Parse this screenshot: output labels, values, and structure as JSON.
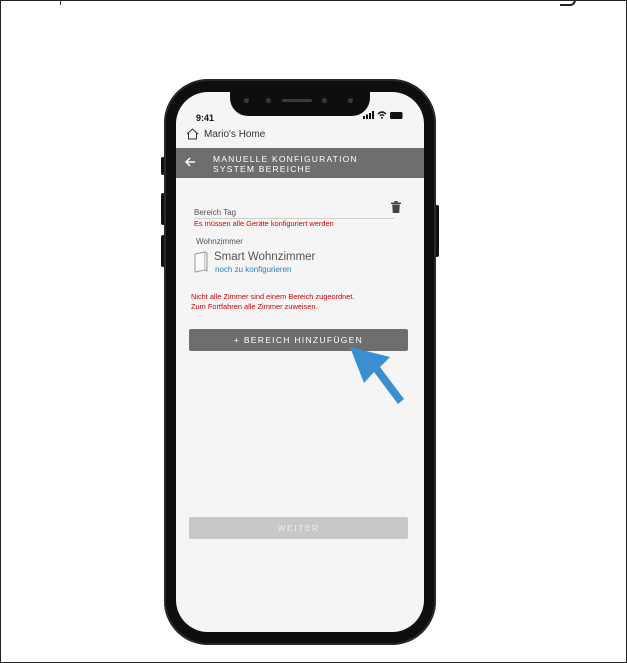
{
  "status_bar": {
    "time": "9:41"
  },
  "home": {
    "title": "Mario's Home"
  },
  "title_bar": {
    "line1": "MANUELLE KONFIGURATION",
    "line2": "SYSTEM BEREICHE"
  },
  "section": {
    "label": "Bereich Tag",
    "error": "Es müssen alle Geräte konfiguriert werden",
    "room": "Wohnzimmer",
    "device_name": "Smart Wohnzimmer",
    "device_status": "noch zu konfigurieren"
  },
  "warning": {
    "line1": "Nicht alle Zimmer sind einem Bereich zugeordnet.",
    "line2": "Zum Fortfahren alle Zimmer zuweisen."
  },
  "buttons": {
    "add_area": "+ BEREICH HINZUFÜGEN",
    "next": "WEITER"
  },
  "colors": {
    "error": "#d40000",
    "link": "#2a82c4",
    "pointer": "#3a8fd0",
    "title_bar": "#6e6e6e"
  }
}
